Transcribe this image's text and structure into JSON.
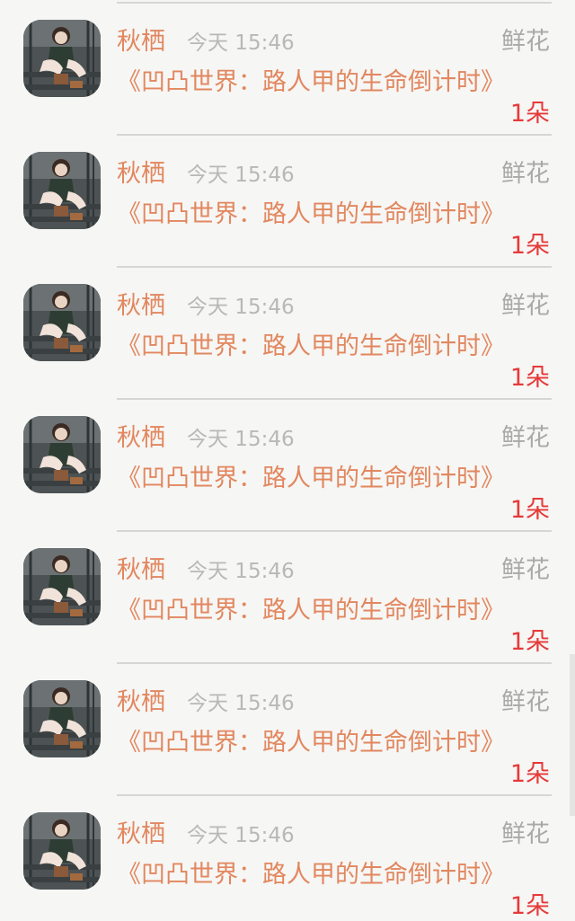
{
  "gift_list": {
    "items": [
      {
        "name": "秋栖",
        "time": "今天 15:46",
        "gift_type": "鲜花",
        "book_title": "《凹凸世界：路人甲的生命倒计时》",
        "count": "1朵"
      },
      {
        "name": "秋栖",
        "time": "今天 15:46",
        "gift_type": "鲜花",
        "book_title": "《凹凸世界：路人甲的生命倒计时》",
        "count": "1朵"
      },
      {
        "name": "秋栖",
        "time": "今天 15:46",
        "gift_type": "鲜花",
        "book_title": "《凹凸世界：路人甲的生命倒计时》",
        "count": "1朵"
      },
      {
        "name": "秋栖",
        "time": "今天 15:46",
        "gift_type": "鲜花",
        "book_title": "《凹凸世界：路人甲的生命倒计时》",
        "count": "1朵"
      },
      {
        "name": "秋栖",
        "time": "今天 15:46",
        "gift_type": "鲜花",
        "book_title": "《凹凸世界：路人甲的生命倒计时》",
        "count": "1朵"
      },
      {
        "name": "秋栖",
        "time": "今天 15:46",
        "gift_type": "鲜花",
        "book_title": "《凹凸世界：路人甲的生命倒计时》",
        "count": "1朵"
      },
      {
        "name": "秋栖",
        "time": "今天 15:46",
        "gift_type": "鲜花",
        "book_title": "《凹凸世界：路人甲的生命倒计时》",
        "count": "1朵"
      }
    ]
  },
  "colors": {
    "name_orange": "#e2875f",
    "count_red": "#e53a3a",
    "meta_gray": "#b8b8b8",
    "background": "#f6f6f4"
  }
}
